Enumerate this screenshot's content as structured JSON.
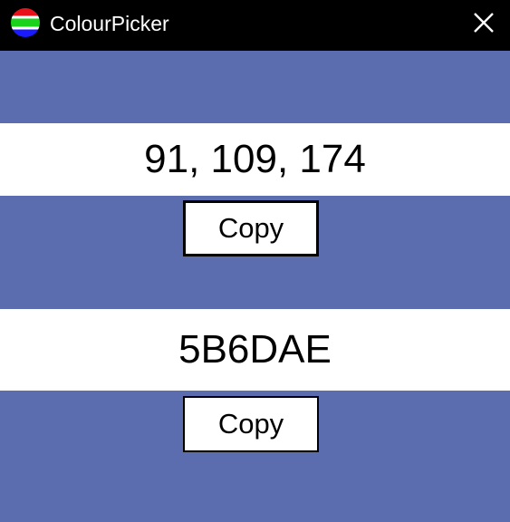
{
  "window": {
    "title": "ColourPicker",
    "icon": "colour-stripes-icon",
    "close_icon": "close-icon"
  },
  "colour": {
    "rgb": "91, 109, 174",
    "hex": "5B6DAE",
    "background": "#5B6DAE"
  },
  "buttons": {
    "copy_rgb_label": "Copy",
    "copy_hex_label": "Copy"
  },
  "colors": {
    "titlebar": "#000000",
    "band": "#FFFFFF",
    "icon_red": "#E8111A",
    "icon_green": "#19D219",
    "icon_blue": "#1A1AFF"
  }
}
